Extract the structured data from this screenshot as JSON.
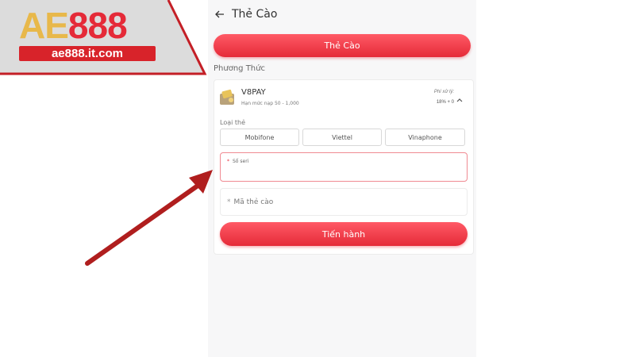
{
  "logo": {
    "brand_gold": "AE",
    "brand_red": "888",
    "domain": "ae888.it.com"
  },
  "header": {
    "title": "Thẻ Cào",
    "back_icon": "arrow-left-icon"
  },
  "tab": {
    "label": "Thẻ Cào"
  },
  "method": {
    "section_label": "Phương Thức",
    "provider": {
      "name": "V8PAY",
      "limit": "Hạn mức nạp 50 - 1,000",
      "fee_label": "Phí xử lý:",
      "fee_value": "18% + 0",
      "icon": "wallet-icon"
    },
    "card_type_label": "Loại thẻ",
    "carriers": [
      "Mobifone",
      "Viettel",
      "Vinaphone"
    ],
    "serial": {
      "required": "*",
      "label": "Số seri"
    },
    "code": {
      "required": "*",
      "label": "Mã thẻ cào"
    },
    "submit_label": "Tiến hành"
  },
  "colors": {
    "accent": "#e52a38",
    "gold": "#e8b84a",
    "arrow": "#b01e1e"
  }
}
